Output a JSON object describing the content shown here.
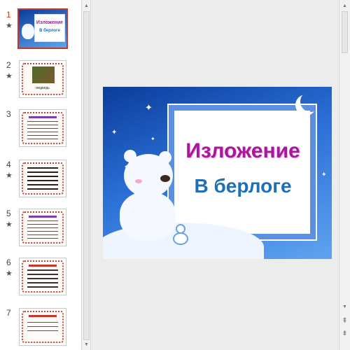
{
  "thumbnails": [
    {
      "number": "1",
      "starred": true,
      "active": true,
      "title": "Изложение",
      "subtitle": "В берлоге"
    },
    {
      "number": "2",
      "starred": true,
      "active": false,
      "caption": "медведь"
    },
    {
      "number": "3",
      "starred": false,
      "active": false
    },
    {
      "number": "4",
      "starred": true,
      "active": false
    },
    {
      "number": "5",
      "starred": true,
      "active": false
    },
    {
      "number": "6",
      "starred": true,
      "active": false
    },
    {
      "number": "7",
      "starred": false,
      "active": false
    }
  ],
  "star_glyph": "★",
  "slide": {
    "title": "Изложение",
    "subtitle": "В берлоге"
  },
  "icons": {
    "scroll_up": "▲",
    "scroll_down": "▼",
    "prev_slide": "⇞",
    "next_slide": "⇟"
  },
  "colors": {
    "active_thumb_border": "#c0392b",
    "title_color": "#a8179c",
    "subtitle_color": "#1e6fb8",
    "slide_bg": "#2a6fd6"
  }
}
